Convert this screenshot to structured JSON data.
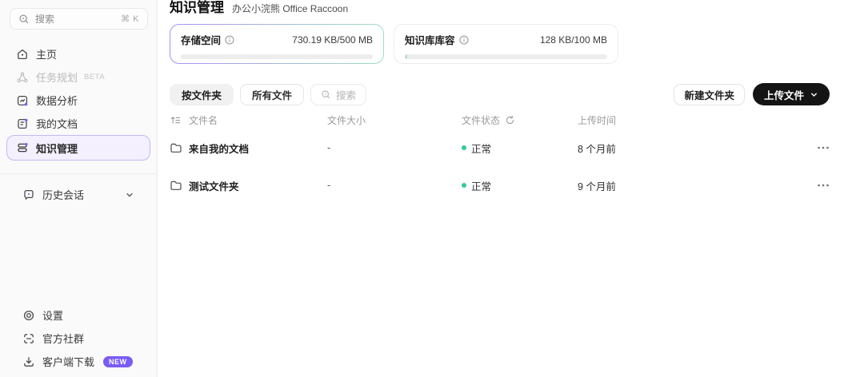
{
  "colors": {
    "accent_purple": "#7b5bf5",
    "status_green": "#35c7a0",
    "selected_bg": "#f4f0fe",
    "selected_border": "#c7b7f8",
    "dark_button": "#141414",
    "card_gradient_left": "#a98ef5",
    "card_gradient_right": "#9edfc4"
  },
  "sidebar": {
    "search": {
      "label": "搜索",
      "shortcut": "⌘ K",
      "icon": "search-icon"
    },
    "nav": [
      {
        "label": "主页",
        "icon": "home-icon"
      },
      {
        "label": "任务规划",
        "badge": "BETA",
        "icon": "task-planning-icon"
      },
      {
        "label": "数据分析",
        "icon": "data-analysis-icon"
      },
      {
        "label": "我的文档",
        "icon": "my-documents-icon"
      },
      {
        "label": "知识管理",
        "icon": "knowledge-icon",
        "selected": true
      }
    ],
    "history": {
      "label": "历史会话",
      "icon": "chat-history-icon",
      "chevron": "chevron-down-icon"
    },
    "footer": [
      {
        "label": "设置",
        "icon": "settings-icon"
      },
      {
        "label": "官方社群",
        "icon": "community-icon"
      },
      {
        "label": "客户端下载",
        "icon": "download-icon",
        "badge": "NEW"
      }
    ]
  },
  "header": {
    "title": "知识管理",
    "subtitle": "办公小浣熊 Office Raccoon"
  },
  "storage_cards": [
    {
      "label": "存储空间",
      "usage": "730.19 KB/500 MB",
      "progress_percent": 0.14,
      "info_icon": "info-icon"
    },
    {
      "label": "知识库库容",
      "usage": "128 KB/100 MB",
      "progress_percent": 1.2,
      "info_icon": "info-icon"
    }
  ],
  "toolbar": {
    "by_folder": "按文件夹",
    "all_files": "所有文件",
    "search": "搜索",
    "new_folder": "新建文件夹",
    "upload": "上传文件"
  },
  "table": {
    "headers": {
      "name": "文件名",
      "size": "文件大小",
      "status": "文件状态",
      "time": "上传时间"
    },
    "rows": [
      {
        "name": "来自我的文档",
        "size": "-",
        "status": "正常",
        "time": "8 个月前"
      },
      {
        "name": "测试文件夹",
        "size": "-",
        "status": "正常",
        "time": "9 个月前"
      }
    ]
  }
}
